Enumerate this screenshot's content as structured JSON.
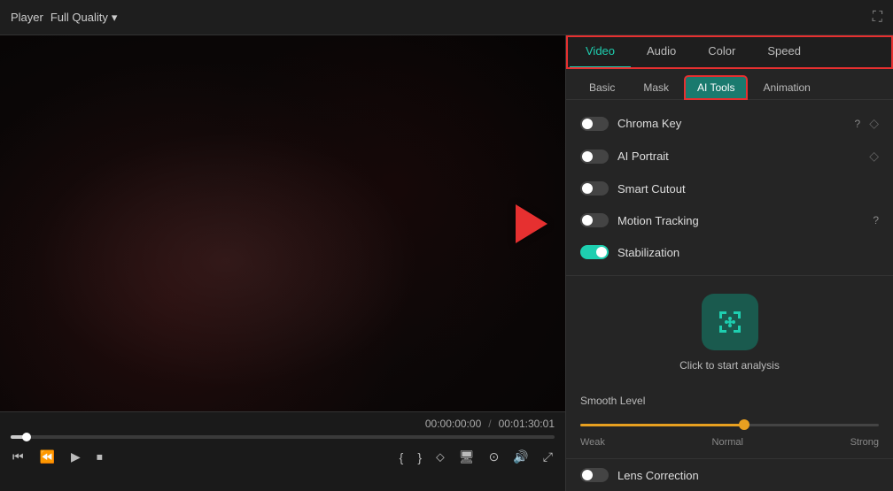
{
  "topBar": {
    "playerLabel": "Player",
    "qualityLabel": "Full Quality",
    "chevron": "▾"
  },
  "timeDisplay": {
    "current": "00:00:00:00",
    "separator": "/",
    "total": "00:01:30:01"
  },
  "rightPanel": {
    "topTabs": [
      {
        "id": "video",
        "label": "Video",
        "active": true
      },
      {
        "id": "audio",
        "label": "Audio",
        "active": false
      },
      {
        "id": "color",
        "label": "Color",
        "active": false
      },
      {
        "id": "speed",
        "label": "Speed",
        "active": false
      }
    ],
    "subTabs": [
      {
        "id": "basic",
        "label": "Basic",
        "active": false
      },
      {
        "id": "mask",
        "label": "Mask",
        "active": false
      },
      {
        "id": "ai-tools",
        "label": "AI Tools",
        "active": true
      },
      {
        "id": "animation",
        "label": "Animation",
        "active": false
      }
    ],
    "aiTools": [
      {
        "id": "chroma-key",
        "label": "Chroma Key",
        "hasHelp": true,
        "toggleState": "off",
        "hasAction": true
      },
      {
        "id": "ai-portrait",
        "label": "AI Portrait",
        "hasHelp": false,
        "toggleState": "off",
        "hasAction": true
      },
      {
        "id": "smart-cutout",
        "label": "Smart Cutout",
        "hasHelp": false,
        "toggleState": "off",
        "hasAction": false
      },
      {
        "id": "motion-tracking",
        "label": "Motion Tracking",
        "hasHelp": true,
        "toggleState": "off",
        "hasAction": false
      },
      {
        "id": "stabilization",
        "label": "Stabilization",
        "hasHelp": false,
        "toggleState": "on",
        "hasAction": false
      }
    ],
    "analysisButton": {
      "label": "Click to start analysis"
    },
    "smoothLevel": {
      "title": "Smooth Level",
      "labels": [
        "Weak",
        "Normal",
        "Strong"
      ]
    },
    "lensCorrection": {
      "label": "Lens Correction",
      "toggleState": "off"
    }
  }
}
